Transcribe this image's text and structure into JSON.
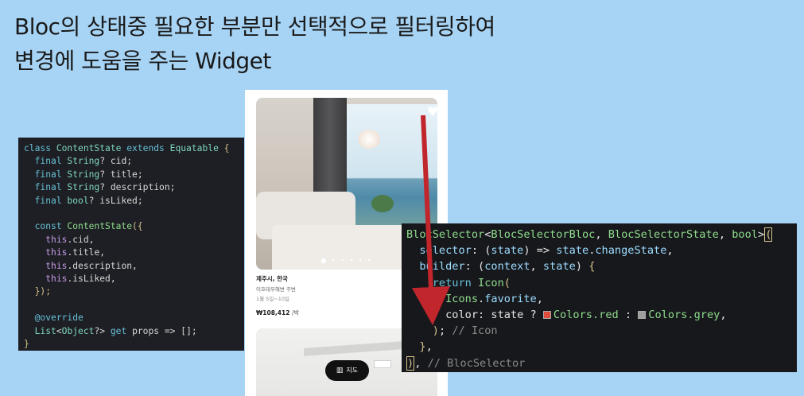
{
  "title": {
    "line1": "Bloc의 상태중 필요한 부분만 선택적으로 필터링하여",
    "line2": "변경에 도움을 주는 Widget"
  },
  "code_left": {
    "lines": [
      "class ContentState extends Equatable {",
      "  final String? cid;",
      "  final String? title;",
      "  final String? description;",
      "  final bool? isLiked;",
      "",
      "  const ContentState({",
      "    this.cid,",
      "    this.title,",
      "    this.description,",
      "    this.isLiked,",
      "  });",
      "",
      "  @override",
      "  List<Object?> get props => [];",
      "}"
    ]
  },
  "code_right": {
    "lines": [
      "BlocSelector<BlocSelectorBloc, BlocSelectorState, bool>(",
      "  selector: (state) => state.changeState,",
      "  builder: (context, state) {",
      "    return Icon(",
      "      Icons.favorite,",
      "      color: state ? ",
      "    ); // Icon",
      "  },",
      "), // BlocSelector"
    ],
    "color_line": {
      "prefix": "      color: state ? ",
      "red": "Colors.red",
      "sep": " : ",
      "grey": "Colors.grey",
      "suffix": ","
    },
    "colors": {
      "red_swatch": "#e04c3c",
      "grey_swatch": "#9e9e9e"
    }
  },
  "phone": {
    "location": "제주시, 한국",
    "subtitle": "이호테우해변 주변",
    "dates": "1월 5일~10일",
    "price": "₩108,412",
    "price_unit": " /박",
    "dots": "● • • • • •",
    "heart_icon": "heart-icon",
    "map_label": "지도",
    "map_icon": "map-icon"
  },
  "arrow": {
    "color": "#c0262c"
  }
}
